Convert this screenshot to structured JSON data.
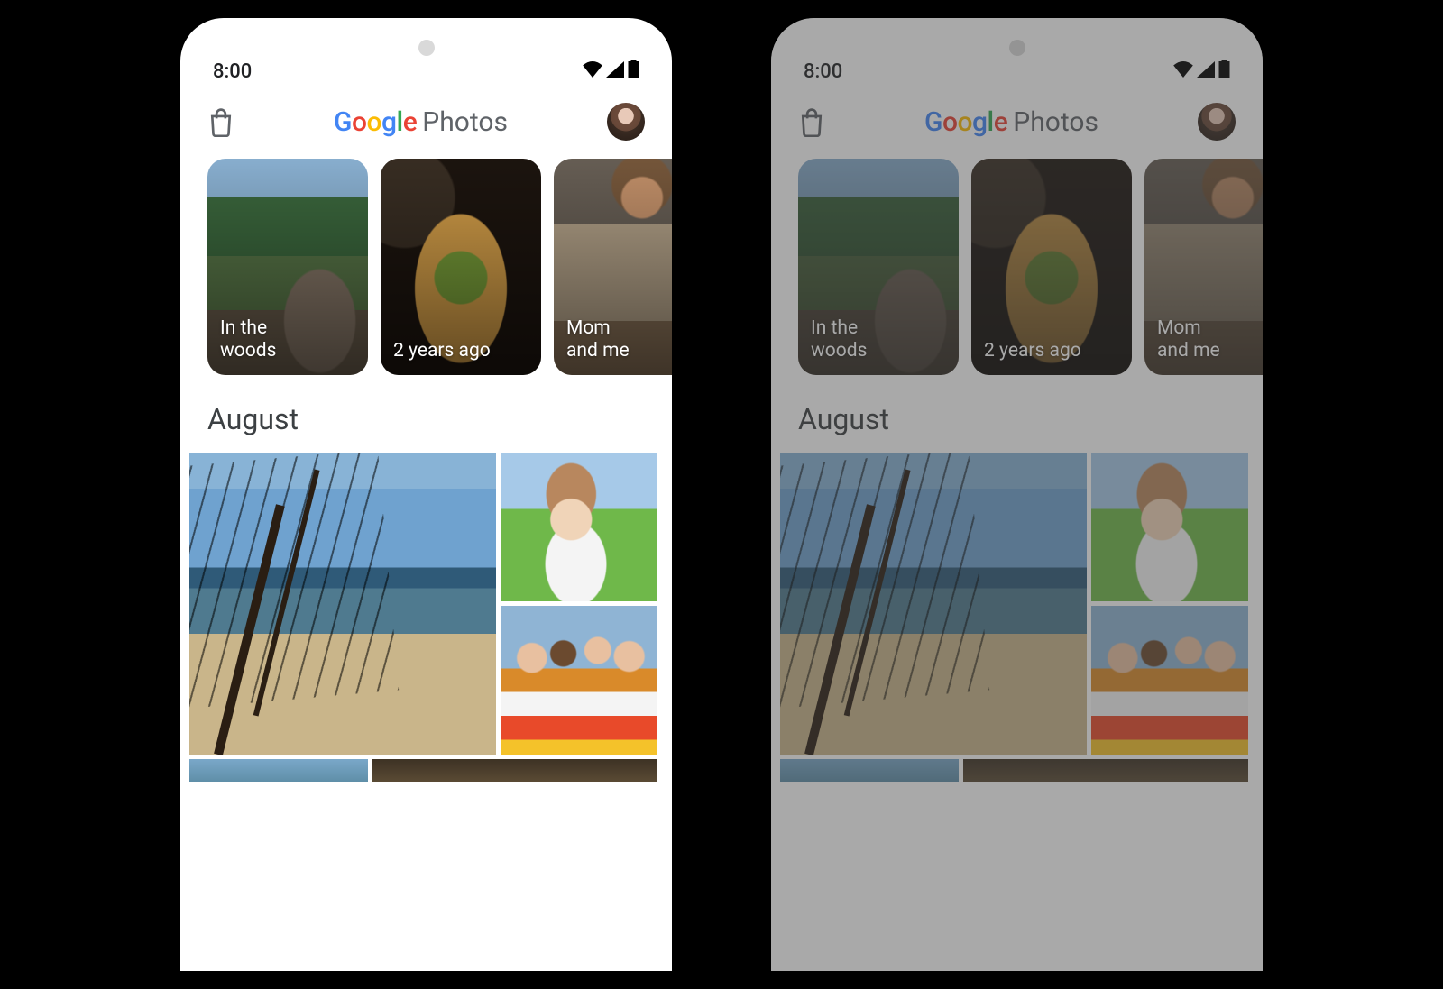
{
  "status": {
    "time": "8:00"
  },
  "header": {
    "google_word": "Google",
    "photos_word": "Photos",
    "icons": {
      "shop": "shop-bag-icon",
      "avatar": "profile-avatar"
    }
  },
  "memories": [
    {
      "id": "woods",
      "label": "In the\nwoods"
    },
    {
      "id": "food",
      "label": "2 years ago"
    },
    {
      "id": "mom",
      "label": "Mom\nand me"
    }
  ],
  "month_section": {
    "title": "August"
  },
  "phones": [
    {
      "variant": "light"
    },
    {
      "variant": "dimmed"
    }
  ]
}
